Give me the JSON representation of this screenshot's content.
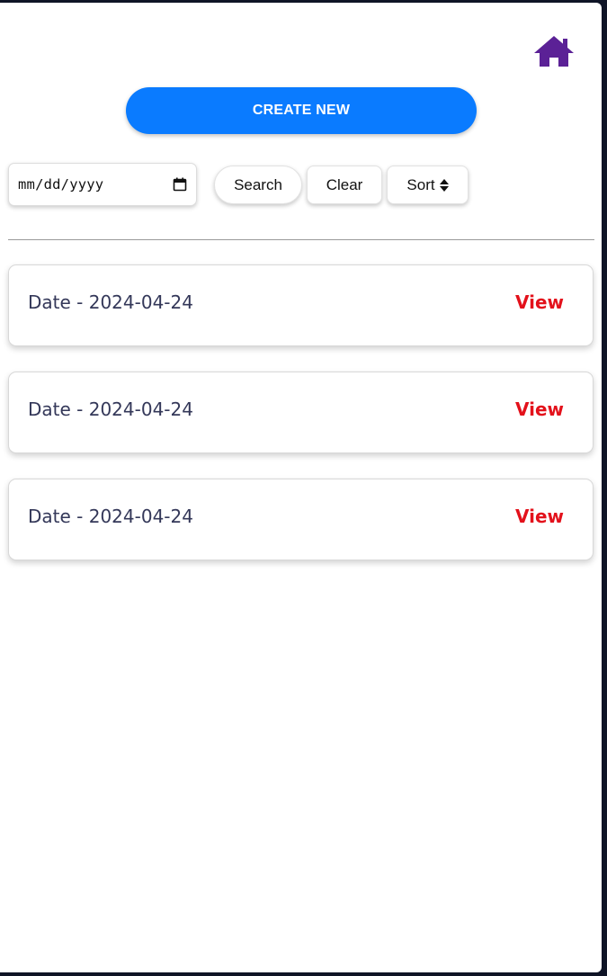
{
  "header": {
    "home_icon": "home-icon",
    "home_color": "#5b2196"
  },
  "toolbar": {
    "create_label": "CREATE NEW",
    "create_color": "#0a7bff",
    "date_placeholder": "mm/dd/yyyy",
    "calendar_icon": "calendar-icon",
    "search_label": "Search",
    "clear_label": "Clear",
    "sort_label": "Sort",
    "sort_icon": "sort-icon"
  },
  "records": [
    {
      "label": "Date - 2024-04-24",
      "action": "View"
    },
    {
      "label": "Date - 2024-04-24",
      "action": "View"
    },
    {
      "label": "Date - 2024-04-24",
      "action": "View"
    }
  ],
  "colors": {
    "view_link": "#e3111b",
    "record_text": "#343859"
  }
}
